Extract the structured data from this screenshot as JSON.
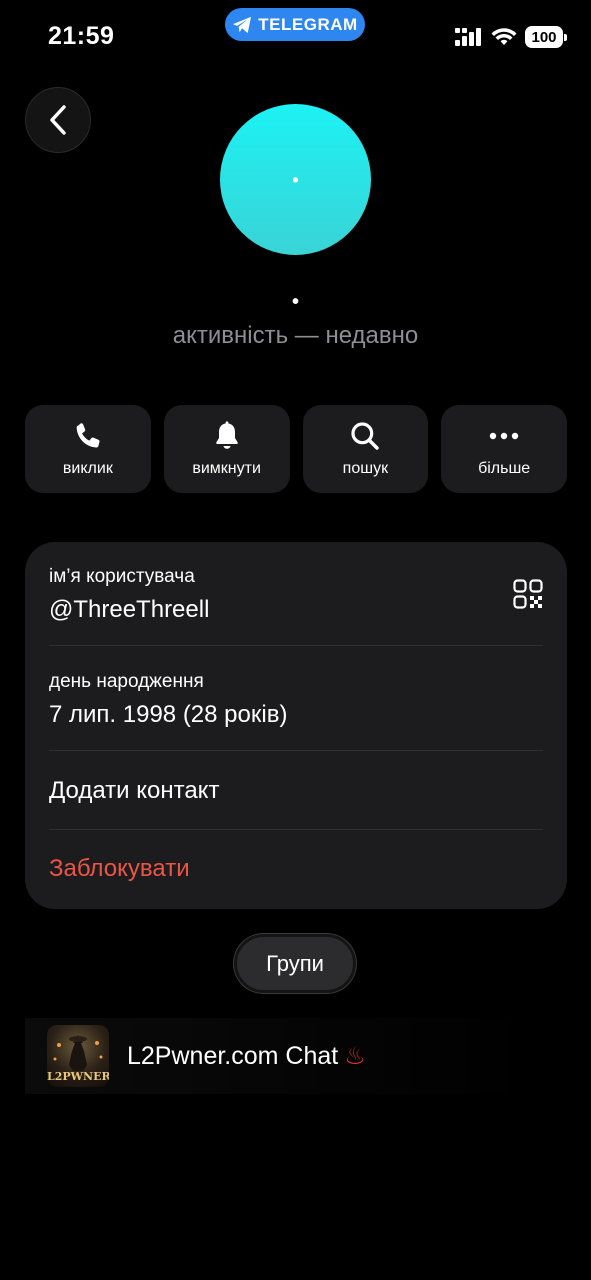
{
  "status_bar": {
    "time": "21:59",
    "pill_label": "TELEGRAM",
    "battery": "100"
  },
  "profile": {
    "avatar_initial": "•",
    "name": "•",
    "status": "активність — недавно"
  },
  "actions": [
    {
      "label": "виклик",
      "icon": "phone-icon"
    },
    {
      "label": "вимкнути",
      "icon": "bell-icon"
    },
    {
      "label": "пошук",
      "icon": "search-icon"
    },
    {
      "label": "більше",
      "icon": "more-icon"
    }
  ],
  "info": {
    "username_label": "ім’я користувача",
    "username_value": "@ThreeThreell",
    "birthday_label": "день народження",
    "birthday_value": "7 лип. 1998 (28 років)",
    "add_contact": "Додати контакт",
    "block": "Заблокувати"
  },
  "tabs": {
    "groups": "Групи"
  },
  "groups": [
    {
      "title": "L2Pwner.com Chat",
      "emoji": "♨",
      "avatar_text": "L2PWNER"
    }
  ],
  "colors": {
    "accent_pill": "#2e86f0",
    "avatar_top": "#1cf2f4",
    "avatar_bottom": "#3ad3d6",
    "danger": "#eb5545",
    "card": "#1c1c1e"
  }
}
